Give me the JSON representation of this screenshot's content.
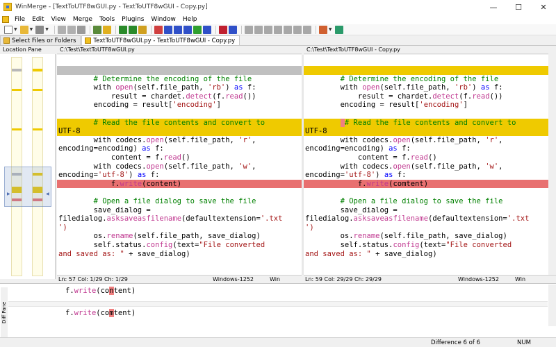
{
  "window": {
    "title": "WinMerge - [TextToUTF8wGUI.py - TextToUTF8wGUI - Copy.py]",
    "minimize": "—",
    "maximize": "☐",
    "close": "✕"
  },
  "menu": [
    "File",
    "Edit",
    "View",
    "Merge",
    "Tools",
    "Plugins",
    "Window",
    "Help"
  ],
  "tabs": [
    {
      "label": "Select Files or Folders",
      "active": false
    },
    {
      "label": "TextToUTF8wGUI.py - TextToUTF8wGUI - Copy.py",
      "active": true
    }
  ],
  "location_pane": {
    "title": "Location Pane"
  },
  "left_pane": {
    "path": "C:\\Test\\TextToUTF8wGUI.py",
    "status": {
      "ln_col": "Ln: 57  Col: 1/29  Ch: 1/29",
      "encoding": "Windows-1252",
      "eol": "Win"
    }
  },
  "right_pane": {
    "path": "C:\\Test\\TextToUTF8wGUI - Copy.py",
    "status": {
      "ln_col": "Ln: 59  Col: 29/29  Ch: 29/29",
      "encoding": "Windows-1252",
      "eol": "Win"
    }
  },
  "code": {
    "c1": "        # Determine the encoding of the file",
    "c2a": "        with ",
    "c2b": "open",
    "c2c": "(self.file_path, ",
    "c2d": "'rb'",
    "c2e": ") ",
    "c2f": "as",
    "c2g": " f:",
    "c3a": "            result = chardet.",
    "c3b": "detect",
    "c3c": "(f.",
    "c3d": "read",
    "c3e": "())",
    "c4a": "        encoding = result[",
    "c4b": "'encoding'",
    "c4c": "]",
    "c5": "        # Read the file contents and convert to",
    "c5r_pre": "        ",
    "c5r_ws": " ",
    "c5r_post": "# Read the file contents and convert to",
    "c6": "UTF-8",
    "c7a": "        with codecs.",
    "c7b": "open",
    "c7c": "(self.file_path, ",
    "c7d": "'r'",
    "c7e": ",",
    "c8a": "encoding=encoding) ",
    "c8b": "as",
    "c8c": " f:",
    "c9a": "            content = f.",
    "c9b": "read",
    "c9c": "()",
    "c10a": "        with codecs.",
    "c10b": "open",
    "c10c": "(self.file_path, ",
    "c10d": "'w'",
    "c10e": ",",
    "c11a": "encoding=",
    "c11b": "'utf-8'",
    "c11c": ") ",
    "c11d": "as",
    "c11e": " f:",
    "c12l_a": "            f.",
    "c12l_b": "write",
    "c12l_c": "(content)",
    "c12r_a": "            f.",
    "c12r_b": "write",
    "c12r_c": "(comtent)",
    "c14": "        # Open a file dialog to save the file",
    "c15": "        save_dialog =",
    "c16a": "filedialog.",
    "c16b": "asksaveasfilename",
    "c16c": "(defaultextension=",
    "c16d": "'.txt",
    "c17": "')",
    "c18a": "        os.",
    "c18b": "rename",
    "c18c": "(self.file_path, save_dialog)",
    "c19a": "        self.status.",
    "c19b": "config",
    "c19c": "(text=",
    "c19d": "\"File converted",
    "c20a": "and saved as: \"",
    "c20b": " + save_dialog)"
  },
  "diff_pane": {
    "label": "Diff Pane",
    "top_a": "f.",
    "top_b": "write",
    "top_c": "(co",
    "top_d": "n",
    "top_e": "tent)",
    "bot_a": "f.",
    "bot_b": "write",
    "bot_c": "(co",
    "bot_d": "m",
    "bot_e": "tent)"
  },
  "statusbar": {
    "difference": "Difference 6 of 6",
    "num": "NUM"
  },
  "colors": {
    "diff_yellow": "#efca00",
    "diff_red": "#e87070",
    "keyword": "#0000ff",
    "function": "#c03890",
    "comment": "#008000",
    "string": "#a31515"
  }
}
